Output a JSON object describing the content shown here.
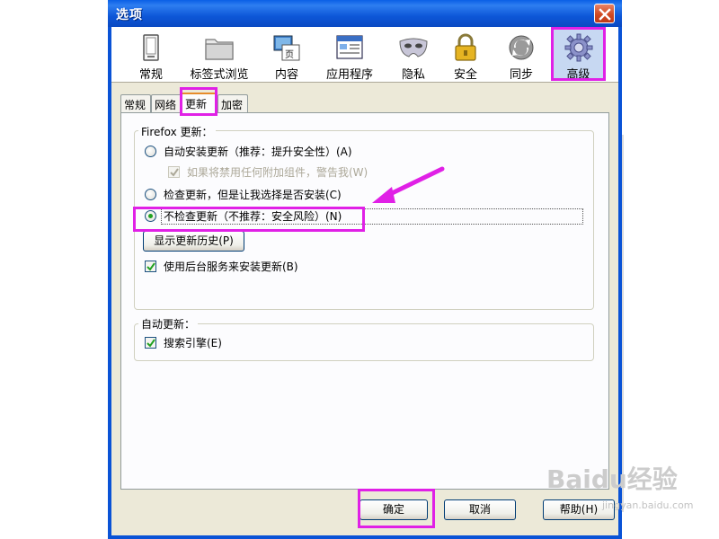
{
  "window": {
    "title": "选项"
  },
  "toolbar": {
    "panes": [
      {
        "label": "常规",
        "icon": "general-icon"
      },
      {
        "label": "标签式浏览",
        "icon": "tabs-icon"
      },
      {
        "label": "内容",
        "icon": "content-icon"
      },
      {
        "label": "应用程序",
        "icon": "applications-icon"
      },
      {
        "label": "隐私",
        "icon": "privacy-mask-icon"
      },
      {
        "label": "安全",
        "icon": "lock-icon"
      },
      {
        "label": "同步",
        "icon": "sync-icon"
      },
      {
        "label": "高级",
        "icon": "gear-icon",
        "selected": true
      }
    ]
  },
  "tabs": [
    {
      "label": "常规"
    },
    {
      "label": "网络"
    },
    {
      "label": "更新",
      "active": true
    },
    {
      "label": "加密"
    }
  ],
  "firefox_updates": {
    "label": "Firefox 更新：",
    "options": [
      {
        "label": "自动安装更新（推荐：提升安全性）(A)",
        "selected": false
      },
      {
        "label": "检查更新，但是让我选择是否安装(C)",
        "selected": false
      },
      {
        "label": "不检查更新（不推荐：安全风险）(N)",
        "selected": true
      }
    ],
    "warn_addons": {
      "label": "如果将禁用任何附加组件，警告我(W)",
      "checked": true,
      "disabled": true
    },
    "show_history_button": "显示更新历史(P)",
    "background_service": {
      "label": "使用后台服务来安装更新(B)",
      "checked": true
    }
  },
  "auto_update": {
    "label": "自动更新：",
    "search_engines": {
      "label": "搜索引擎(E)",
      "checked": true
    }
  },
  "buttons": {
    "ok": "确定",
    "cancel": "取消",
    "help": "帮助(H)"
  },
  "watermark": {
    "text": "Baidu经验",
    "subtext": "jingyan.baidu.com"
  },
  "colors": {
    "title_bar": "#0a5fe6",
    "dialog_bg": "#ece9d8",
    "highlight": "#e020e6",
    "selected_pane": "#c7d8f2"
  }
}
